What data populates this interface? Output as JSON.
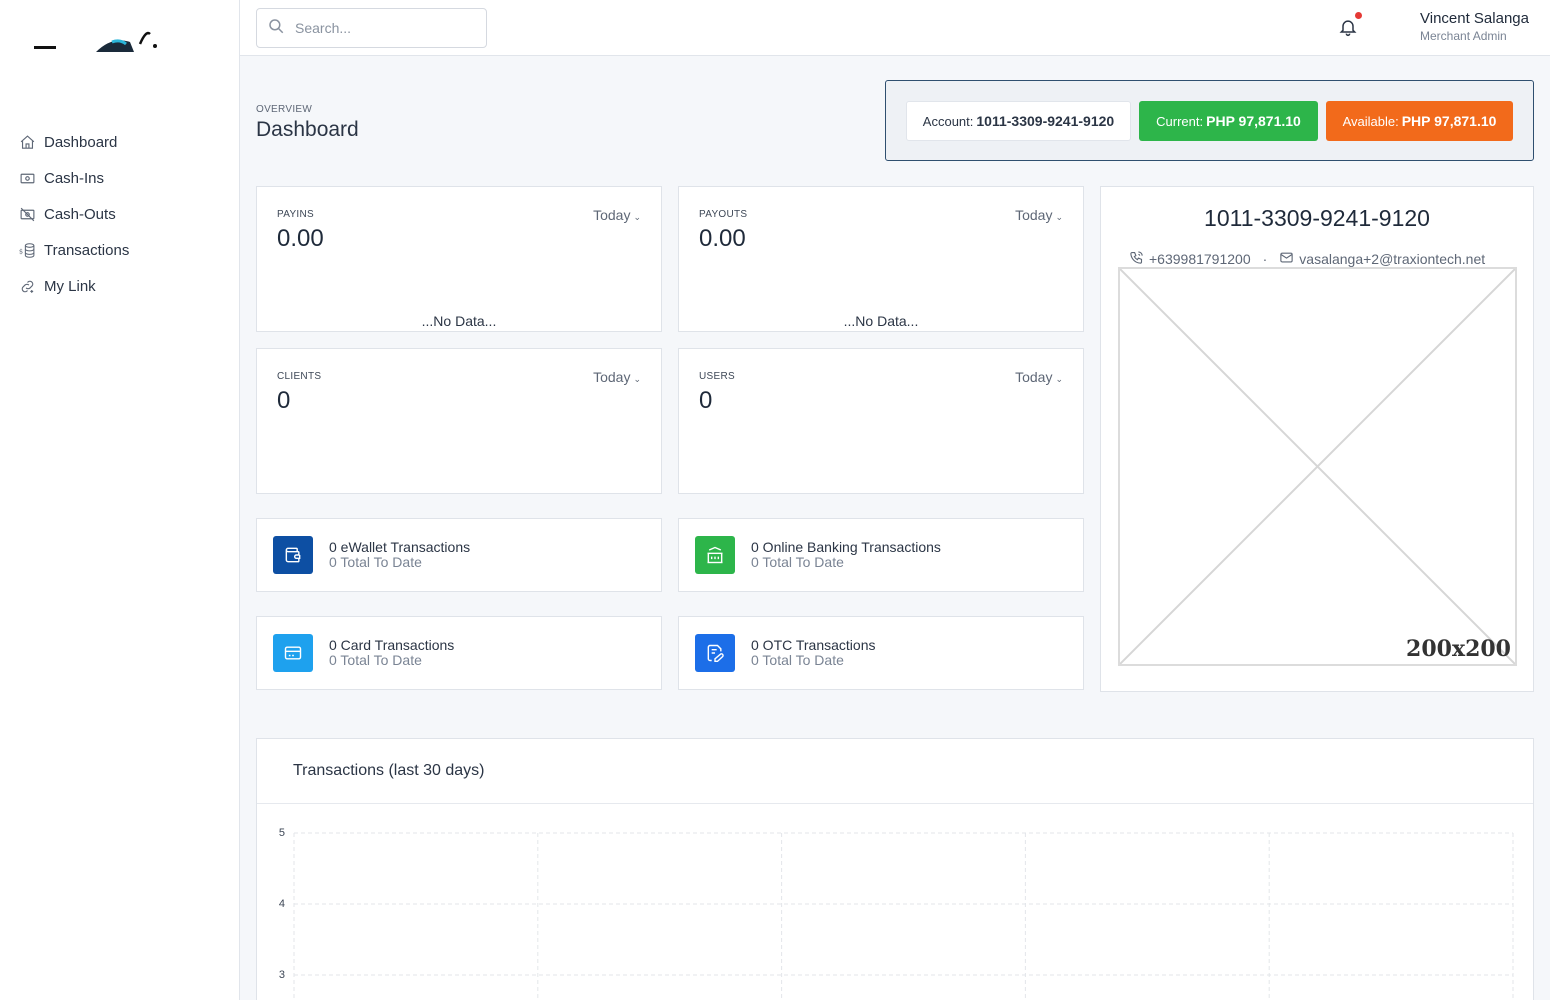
{
  "search": {
    "placeholder": "Search..."
  },
  "user": {
    "name": "Vincent Salanga",
    "role": "Merchant Admin"
  },
  "sidebar": {
    "items": [
      {
        "label": "Dashboard",
        "icon": "home-icon"
      },
      {
        "label": "Cash-Ins",
        "icon": "cash-icon"
      },
      {
        "label": "Cash-Outs",
        "icon": "cash-off-icon"
      },
      {
        "label": "Transactions",
        "icon": "database-dollar-icon"
      },
      {
        "label": "My Link",
        "icon": "link-icon"
      }
    ]
  },
  "header": {
    "overview": "OVERVIEW",
    "title": "Dashboard"
  },
  "account": {
    "account_label": "Account:",
    "account_value": "1011-3309-9241-9120",
    "current_label": "Current:",
    "current_value": "PHP 97,871.10",
    "available_label": "Available:",
    "available_value": "PHP 97,871.10"
  },
  "stats": {
    "payins": {
      "label": "PAYINS",
      "value": "0.00",
      "period": "Today",
      "note": "...No Data..."
    },
    "payouts": {
      "label": "PAYOUTS",
      "value": "0.00",
      "period": "Today",
      "note": "...No Data..."
    },
    "clients": {
      "label": "CLIENTS",
      "value": "0",
      "period": "Today"
    },
    "users": {
      "label": "USERS",
      "value": "0",
      "period": "Today"
    }
  },
  "transaction_types": {
    "ewallet": {
      "title": "0 eWallet Transactions",
      "subtitle": "0 Total To Date",
      "color": "#0d4fa3"
    },
    "banking": {
      "title": "0 Online Banking Transactions",
      "subtitle": "0 Total To Date",
      "color": "#2db54a"
    },
    "card": {
      "title": "0 Card Transactions",
      "subtitle": "0 Total To Date",
      "color": "#1ea1ee"
    },
    "otc": {
      "title": "0 OTC Transactions",
      "subtitle": "0 Total To Date",
      "color": "#1c6ee8"
    }
  },
  "profile": {
    "account_number": "1011-3309-9241-9120",
    "phone": "+639981791200",
    "separator": "·",
    "email": "vasalanga+2@traxiontech.net",
    "image_placeholder": "200x200"
  },
  "chart_data": {
    "type": "line",
    "title": "Transactions (last 30 days)",
    "ylim": [
      3,
      5
    ],
    "yticks": [
      "5",
      "4",
      "3"
    ],
    "grid": true,
    "series": []
  }
}
